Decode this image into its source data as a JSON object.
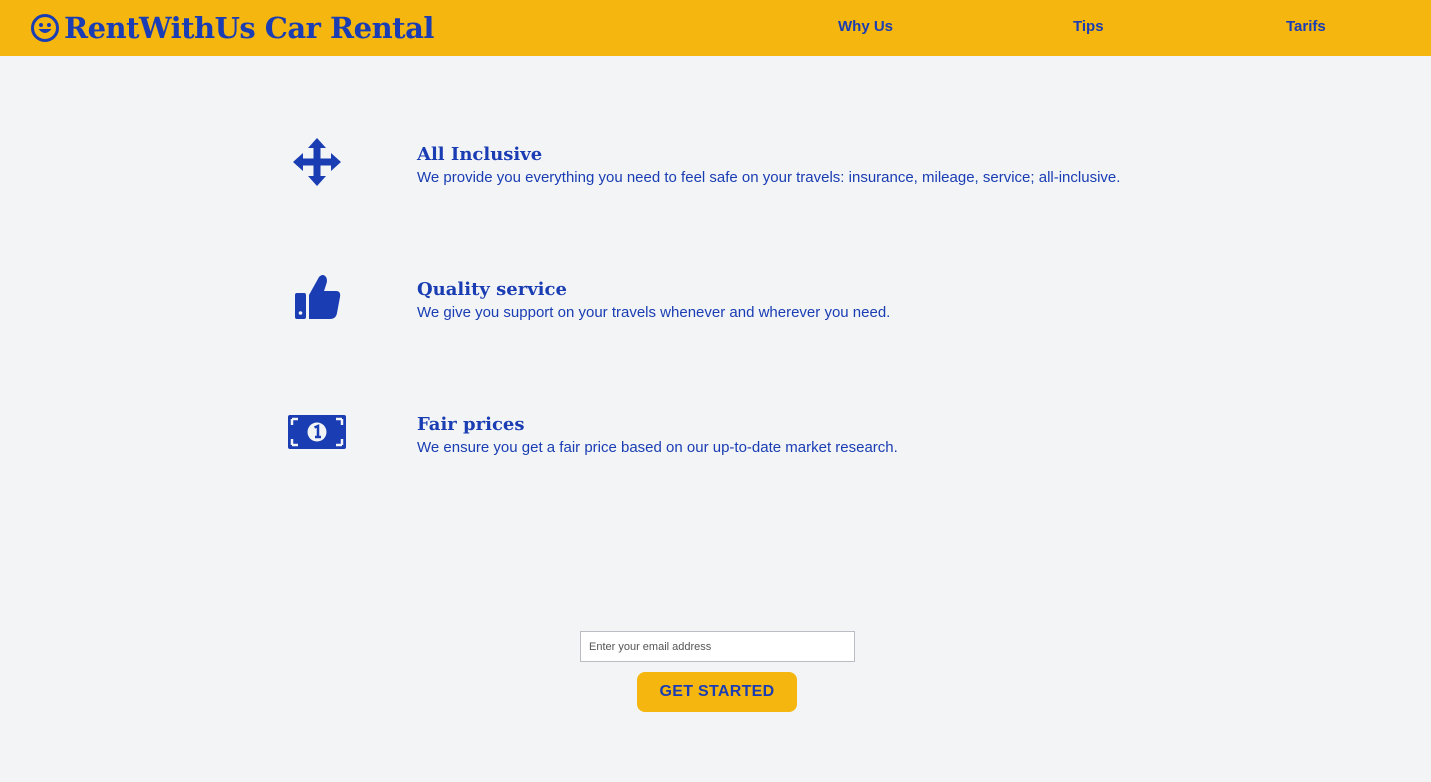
{
  "header": {
    "brand": "RentWithUs Car Rental",
    "brand_icon": "smiling-face-icon",
    "nav": [
      {
        "label": "Why Us"
      },
      {
        "label": "Tips"
      },
      {
        "label": "Tarifs"
      }
    ]
  },
  "features": [
    {
      "icon": "arrows-move-icon",
      "title": "All Inclusive",
      "description": "We provide you everything you need to feel safe on your travels: insurance, mileage, service; all-inclusive."
    },
    {
      "icon": "thumbs-up-icon",
      "title": "Quality service",
      "description": "We give you support on your travels whenever and wherever you need."
    },
    {
      "icon": "money-bill-icon",
      "title": "Fair prices",
      "description": "We ensure you get a fair price based on our up-to-date market research."
    }
  ],
  "signup": {
    "email_placeholder": "Enter your email address",
    "button_label": "GET STARTED"
  },
  "colors": {
    "header_bg": "#f5b60f",
    "accent": "#1a3db3",
    "page_bg": "#f2f4f6"
  }
}
